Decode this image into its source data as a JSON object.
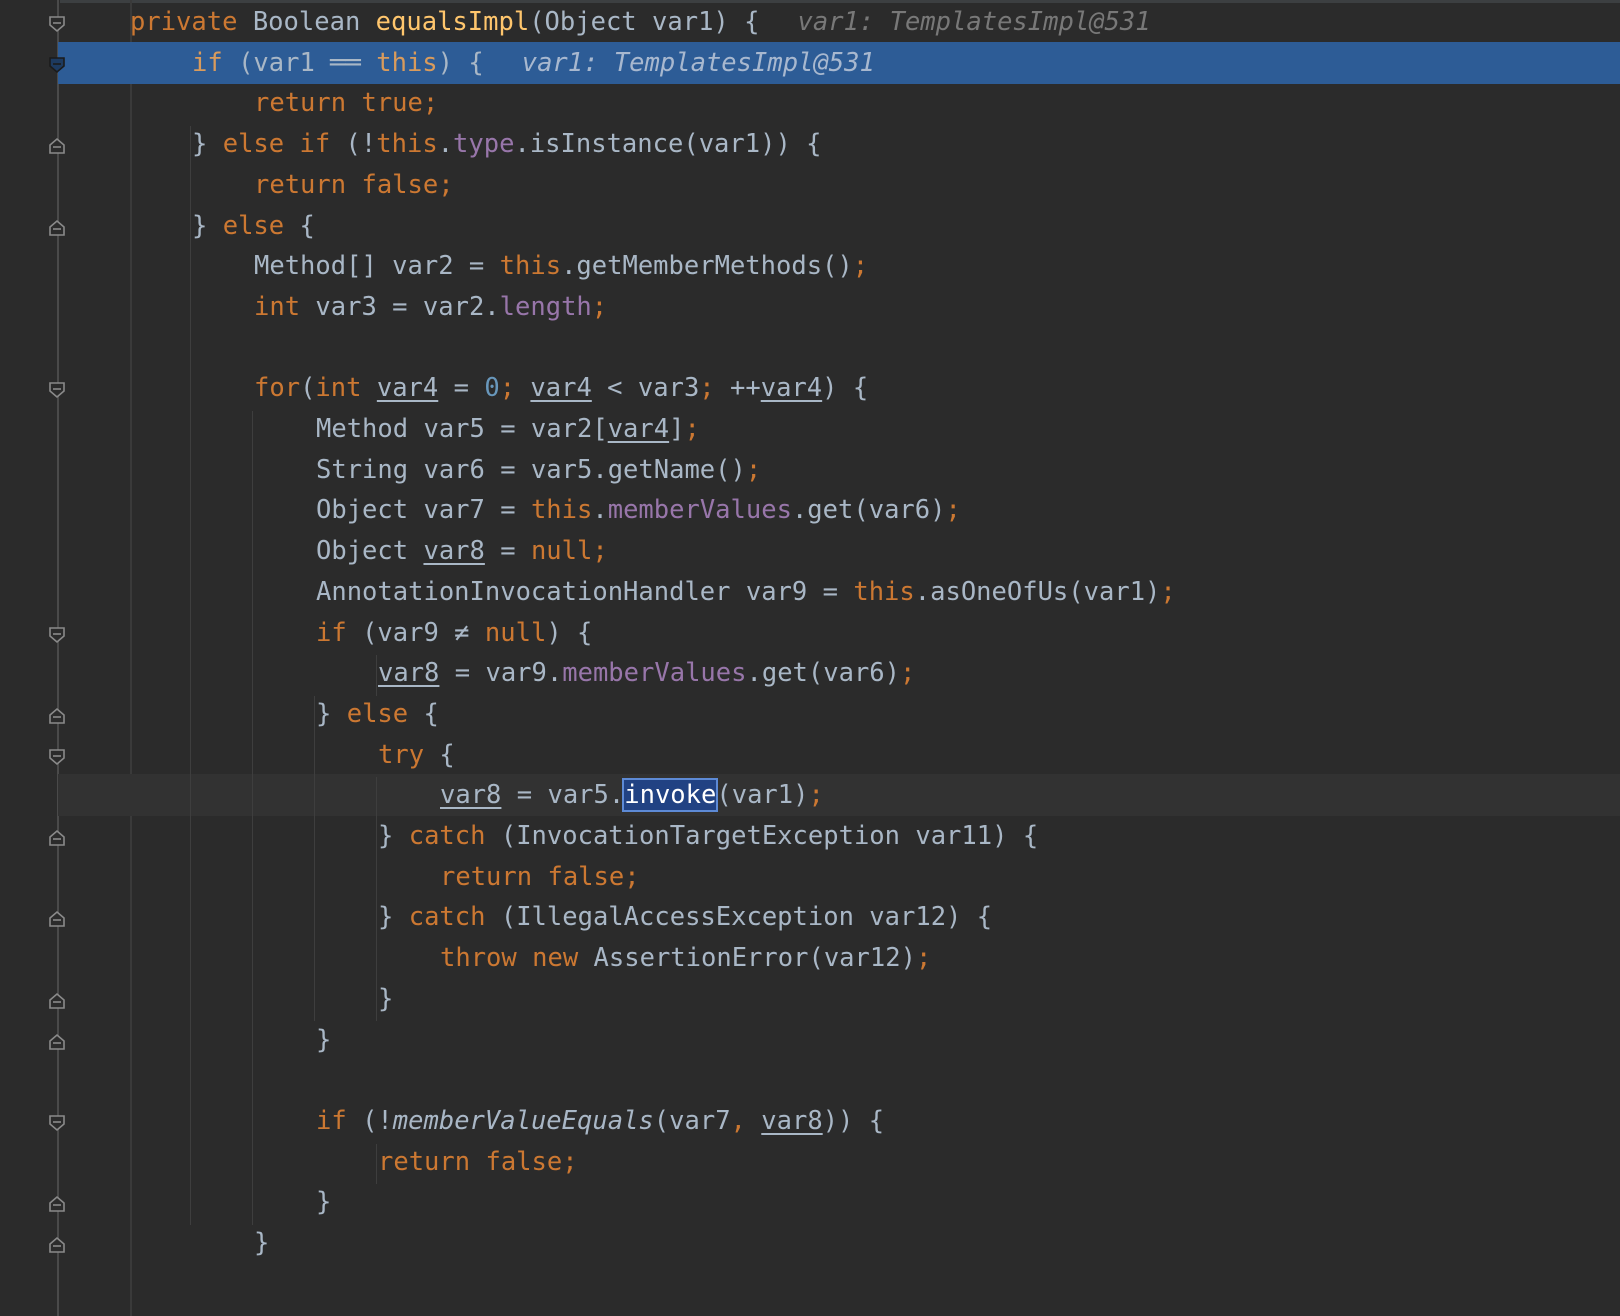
{
  "editor": {
    "lines": [
      {
        "id": "l1",
        "parts": [
          [
            "kw",
            "private "
          ],
          [
            "",
            "Boolean "
          ],
          [
            "fn",
            "equalsImpl"
          ],
          [
            "",
            "(Object var1) {"
          ]
        ],
        "hint": "var1: TemplatesImpl@531"
      },
      {
        "id": "l2",
        "parts": [
          [
            "kw",
            "if "
          ],
          [
            "",
            "(var1 ══ "
          ],
          [
            "kw",
            "this"
          ],
          [
            "",
            ") {"
          ]
        ],
        "hint": "var1: TemplatesImpl@531"
      },
      {
        "id": "l3",
        "parts": [
          [
            "kw",
            "return true"
          ],
          [
            "semi",
            ";"
          ]
        ]
      },
      {
        "id": "l4",
        "parts": [
          [
            "",
            "} "
          ],
          [
            "kw",
            "else if "
          ],
          [
            "",
            "(!"
          ],
          [
            "kw",
            "this"
          ],
          [
            "",
            "."
          ],
          [
            "fld",
            "type"
          ],
          [
            "",
            ".isInstance(var1)) {"
          ]
        ]
      },
      {
        "id": "l5",
        "parts": [
          [
            "kw",
            "return false"
          ],
          [
            "semi",
            ";"
          ]
        ]
      },
      {
        "id": "l6",
        "parts": [
          [
            "",
            "} "
          ],
          [
            "kw",
            "else "
          ],
          [
            "",
            "{"
          ]
        ]
      },
      {
        "id": "l7",
        "parts": [
          [
            "",
            "Method[] var2 = "
          ],
          [
            "kw",
            "this"
          ],
          [
            "",
            ".getMemberMethods()"
          ],
          [
            "semi",
            ";"
          ]
        ]
      },
      {
        "id": "l8",
        "parts": [
          [
            "kw",
            "int "
          ],
          [
            "",
            "var3 = var2."
          ],
          [
            "fld",
            "length"
          ],
          [
            "semi",
            ";"
          ]
        ]
      },
      {
        "id": "l9",
        "parts": []
      },
      {
        "id": "l10",
        "parts": [
          [
            "kw",
            "for"
          ],
          [
            "",
            "("
          ],
          [
            "kw",
            "int "
          ],
          [
            "ul",
            "var4"
          ],
          [
            "",
            " = "
          ],
          [
            "num",
            "0"
          ],
          [
            "semi",
            "; "
          ],
          [
            "ul",
            "var4"
          ],
          [
            "",
            " < var3"
          ],
          [
            "semi",
            "; "
          ],
          [
            "",
            "++"
          ],
          [
            "ul",
            "var4"
          ],
          [
            "",
            ") {"
          ]
        ]
      },
      {
        "id": "l11",
        "parts": [
          [
            "",
            "Method var5 = var2["
          ],
          [
            "ul",
            "var4"
          ],
          [
            "",
            "]"
          ],
          [
            "semi",
            ";"
          ]
        ]
      },
      {
        "id": "l12",
        "parts": [
          [
            "",
            "String var6 = var5.getName()"
          ],
          [
            "semi",
            ";"
          ]
        ]
      },
      {
        "id": "l13",
        "parts": [
          [
            "",
            "Object var7 = "
          ],
          [
            "kw",
            "this"
          ],
          [
            "",
            "."
          ],
          [
            "fld",
            "memberValues"
          ],
          [
            "",
            ".get(var6)"
          ],
          [
            "semi",
            ";"
          ]
        ]
      },
      {
        "id": "l14",
        "parts": [
          [
            "",
            "Object "
          ],
          [
            "ul",
            "var8"
          ],
          [
            "",
            " = "
          ],
          [
            "kw",
            "null"
          ],
          [
            "semi",
            ";"
          ]
        ]
      },
      {
        "id": "l15",
        "parts": [
          [
            "",
            "AnnotationInvocationHandler var9 = "
          ],
          [
            "kw",
            "this"
          ],
          [
            "",
            ".asOneOfUs(var1)"
          ],
          [
            "semi",
            ";"
          ]
        ]
      },
      {
        "id": "l16",
        "parts": [
          [
            "kw",
            "if "
          ],
          [
            "",
            "(var9 ≠ "
          ],
          [
            "kw",
            "null"
          ],
          [
            "",
            ") {"
          ]
        ]
      },
      {
        "id": "l17",
        "parts": [
          [
            "ul",
            "var8"
          ],
          [
            "",
            " = var9."
          ],
          [
            "fld",
            "memberValues"
          ],
          [
            "",
            ".get(var6)"
          ],
          [
            "semi",
            ";"
          ]
        ]
      },
      {
        "id": "l18",
        "parts": [
          [
            "",
            "} "
          ],
          [
            "kw",
            "else "
          ],
          [
            "",
            "{"
          ]
        ]
      },
      {
        "id": "l19",
        "parts": [
          [
            "kw",
            "try "
          ],
          [
            "",
            "{"
          ]
        ]
      },
      {
        "id": "l20",
        "parts": [
          [
            "ul",
            "var8"
          ],
          [
            "",
            " = var5."
          ],
          [
            "sel",
            "invoke"
          ],
          [
            "",
            "(var1)"
          ],
          [
            "semi",
            ";"
          ]
        ]
      },
      {
        "id": "l21",
        "parts": [
          [
            "",
            "} "
          ],
          [
            "kw",
            "catch "
          ],
          [
            "",
            "(InvocationTargetException var11) {"
          ]
        ]
      },
      {
        "id": "l22",
        "parts": [
          [
            "kw",
            "return false"
          ],
          [
            "semi",
            ";"
          ]
        ]
      },
      {
        "id": "l23",
        "parts": [
          [
            "",
            "} "
          ],
          [
            "kw",
            "catch "
          ],
          [
            "",
            "(IllegalAccessException var12) {"
          ]
        ]
      },
      {
        "id": "l24",
        "parts": [
          [
            "kw",
            "throw new "
          ],
          [
            "",
            "AssertionError(var12)"
          ],
          [
            "semi",
            ";"
          ]
        ]
      },
      {
        "id": "l25",
        "parts": [
          [
            "",
            "}"
          ]
        ]
      },
      {
        "id": "l26",
        "parts": [
          [
            "",
            "}"
          ]
        ]
      },
      {
        "id": "l27",
        "parts": []
      },
      {
        "id": "l28",
        "parts": [
          [
            "kw",
            "if "
          ],
          [
            "",
            "(!"
          ],
          [
            "ital",
            "memberValueEquals"
          ],
          [
            "",
            "(var7"
          ],
          [
            "semi",
            ", "
          ],
          [
            "ul",
            "var8"
          ],
          [
            "",
            ")) {"
          ]
        ]
      },
      {
        "id": "l29",
        "parts": [
          [
            "kw",
            "return false"
          ],
          [
            "semi",
            ";"
          ]
        ]
      },
      {
        "id": "l30",
        "parts": [
          [
            "",
            "}"
          ]
        ]
      },
      {
        "id": "l31",
        "parts": [
          [
            "",
            "}"
          ]
        ]
      }
    ]
  },
  "colors": {
    "background": "#2b2b2b",
    "keyword": "#cc7832",
    "method_decl": "#ffc66d",
    "field": "#9876aa",
    "number": "#6897bb",
    "execution_line": "#2d5c96",
    "inline_hint": "#787878"
  },
  "icons": {
    "fold_open": "fold-open-icon",
    "fold_close": "fold-close-icon"
  }
}
